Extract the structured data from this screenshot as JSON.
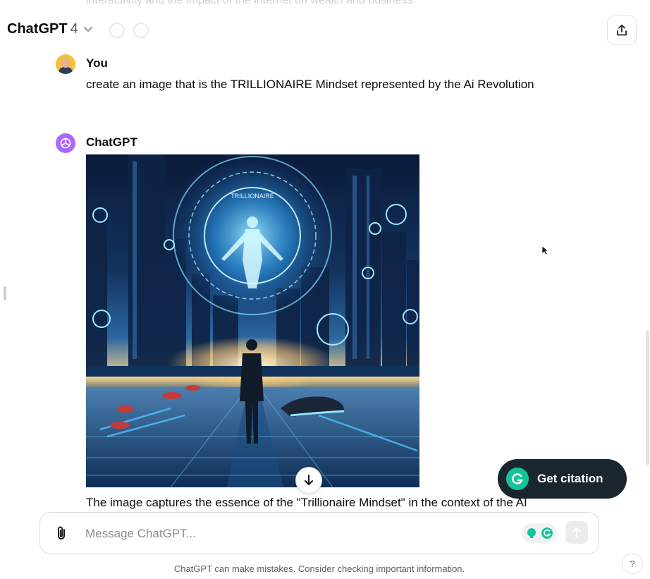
{
  "header": {
    "model_name": "ChatGPT",
    "model_version": "4",
    "faded_previous_text": "interactivity and the impact of the internet on wealth and business."
  },
  "messages": {
    "user": {
      "author": "You",
      "text": "create an image that is the TRILLIONAIRE Mindset represented by the Ai Revolution"
    },
    "assistant": {
      "author": "ChatGPT",
      "image_ring_text": "TRILLIONAIRE",
      "reply_text": "The image captures the essence of the \"Trillionaire Mindset\" in the context of the AI"
    }
  },
  "citation": {
    "label": "Get citation"
  },
  "composer": {
    "placeholder": "Message ChatGPT..."
  },
  "footer": {
    "disclaimer": "ChatGPT can make mistakes. Consider checking important information.",
    "help": "?"
  },
  "colors": {
    "assistant_avatar": "#ab68ff",
    "citation_bg": "#19262f",
    "grammarly_green": "#15c39a"
  },
  "icons": [
    "chevron-down-icon",
    "share-icon",
    "openai-logo-icon",
    "download-arrow-icon",
    "paperclip-icon",
    "grammarly-icon",
    "send-arrow-icon",
    "question-icon",
    "mouse-cursor-icon"
  ]
}
